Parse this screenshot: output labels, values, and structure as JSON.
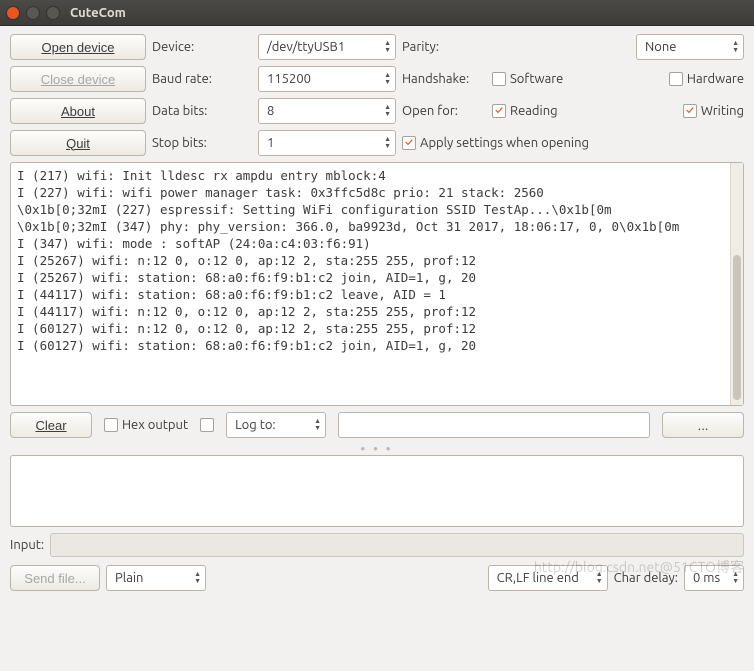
{
  "title": "CuteCom",
  "buttons": {
    "open": "Open device",
    "close": "Close device",
    "about": "About",
    "quit": "Quit",
    "clear": "Clear",
    "browse": "...",
    "sendfile": "Send file..."
  },
  "labels": {
    "device": "Device:",
    "baud": "Baud rate:",
    "databits": "Data bits:",
    "stopbits": "Stop bits:",
    "parity": "Parity:",
    "handshake": "Handshake:",
    "openfor": "Open for:",
    "hexoutput": "Hex output",
    "logto": "Log to:",
    "input": "Input:",
    "chardelay": "Char delay:"
  },
  "values": {
    "device": "/dev/ttyUSB1",
    "baud": "115200",
    "databits": "8",
    "stopbits": "1",
    "parity": "None",
    "lineend": "CR,LF line end",
    "chardelay": "0 ms",
    "fileproto": "Plain"
  },
  "checkboxes": {
    "software": "Software",
    "hardware": "Hardware",
    "reading": "Reading",
    "writing": "Writing",
    "applysettings": "Apply settings when opening"
  },
  "terminal_lines": [
    "I (217) wifi: Init lldesc rx ampdu entry mblock:4",
    "I (227) wifi: wifi power manager task: 0x3ffc5d8c prio: 21 stack: 2560",
    "\\0x1b[0;32mI (227) espressif: Setting WiFi configuration SSID TestAp...\\0x1b[0m",
    "\\0x1b[0;32mI (347) phy: phy_version: 366.0, ba9923d, Oct 31 2017, 18:06:17, 0, 0\\0x1b[0m",
    "I (347) wifi: mode : softAP (24:0a:c4:03:f6:91)",
    "I (25267) wifi: n:12 0, o:12 0, ap:12 2, sta:255 255, prof:12",
    "I (25267) wifi: station: 68:a0:f6:f9:b1:c2 join, AID=1, g, 20",
    "I (44117) wifi: station: 68:a0:f6:f9:b1:c2 leave, AID = 1",
    "I (44117) wifi: n:12 0, o:12 0, ap:12 2, sta:255 255, prof:12",
    "I (60127) wifi: n:12 0, o:12 0, ap:12 2, sta:255 255, prof:12",
    "I (60127) wifi: station: 68:a0:f6:f9:b1:c2 join, AID=1, g, 20"
  ],
  "watermark": "http://blog.csdn.net@51CTO博客"
}
